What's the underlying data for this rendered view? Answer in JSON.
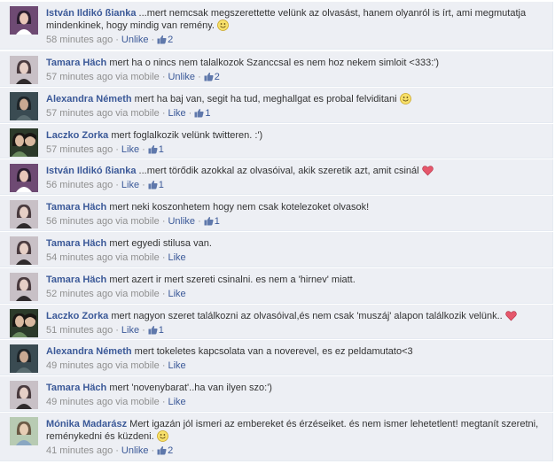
{
  "comments": [
    {
      "author": "István Ildikó ßianka",
      "text": "...mert nemcsak megszerettette velünk az olvasást, hanem olyanról is írt, ami megmutatja mindenkinek, hogy mindig van remény.",
      "emoji": "smile-icon",
      "time": "58 minutes ago",
      "via": "",
      "action": "Unlike",
      "likes": "2",
      "avatar": "purple"
    },
    {
      "author": "Tamara Häch",
      "text": "mert ha o nincs nem talalkozok Szanccsal es nem hoz nekem simloit <333:')",
      "emoji": "",
      "time": "57 minutes ago",
      "via": "via mobile",
      "action": "Unlike",
      "likes": "2",
      "avatar": "girl"
    },
    {
      "author": "Alexandra Németh",
      "text": "mert ha baj van, segit ha tud, meghallgat es probal felviditani",
      "emoji": "smile-icon",
      "time": "57 minutes ago",
      "via": "via mobile",
      "action": "Like",
      "likes": "1",
      "avatar": "dark"
    },
    {
      "author": "Laczko Zorka",
      "text": "mert foglalkozik velünk twitteren. :')",
      "emoji": "",
      "time": "57 minutes ago",
      "via": "",
      "action": "Like",
      "likes": "1",
      "avatar": "duo"
    },
    {
      "author": "István Ildikó ßianka",
      "text": "...mert törődik azokkal az olvasóival, akik szeretik azt, amit csinál",
      "emoji": "heart-icon",
      "time": "56 minutes ago",
      "via": "",
      "action": "Like",
      "likes": "1",
      "avatar": "purple"
    },
    {
      "author": "Tamara Häch",
      "text": "mert neki koszonhetem hogy nem csak kotelezoket olvasok!",
      "emoji": "",
      "time": "56 minutes ago",
      "via": "via mobile",
      "action": "Unlike",
      "likes": "1",
      "avatar": "girl"
    },
    {
      "author": "Tamara Häch",
      "text": "mert egyedi stilusa van.",
      "emoji": "",
      "time": "54 minutes ago",
      "via": "via mobile",
      "action": "Like",
      "likes": "",
      "avatar": "girl"
    },
    {
      "author": "Tamara Häch",
      "text": "mert azert ir mert szereti csinalni. es nem a 'hirnev' miatt.",
      "emoji": "",
      "time": "52 minutes ago",
      "via": "via mobile",
      "action": "Like",
      "likes": "",
      "avatar": "girl"
    },
    {
      "author": "Laczko Zorka",
      "text": "mert nagyon szeret találkozni az olvasóival,és nem csak 'muszáj' alapon találkozik velünk..",
      "emoji": "heart-icon",
      "time": "51 minutes ago",
      "via": "",
      "action": "Like",
      "likes": "1",
      "avatar": "duo"
    },
    {
      "author": "Alexandra Németh",
      "text": "mert tokeletes kapcsolata van a noverevel, es ez peldamutato<3",
      "emoji": "",
      "time": "49 minutes ago",
      "via": "via mobile",
      "action": "Like",
      "likes": "",
      "avatar": "dark"
    },
    {
      "author": "Tamara Häch",
      "text": "mert 'novenybarat'..ha van ilyen szo:')",
      "emoji": "",
      "time": "49 minutes ago",
      "via": "via mobile",
      "action": "Like",
      "likes": "",
      "avatar": "girl"
    },
    {
      "author": "Mónika Madarász",
      "text": "Mert igazán jól ismeri az embereket és érzéseiket. és nem ismer lehetetlent! megtanít szeretni, reménykedni és küzdeni.",
      "emoji": "smile-icon",
      "time": "41 minutes ago",
      "via": "",
      "action": "Unlike",
      "likes": "2",
      "avatar": "light"
    }
  ]
}
